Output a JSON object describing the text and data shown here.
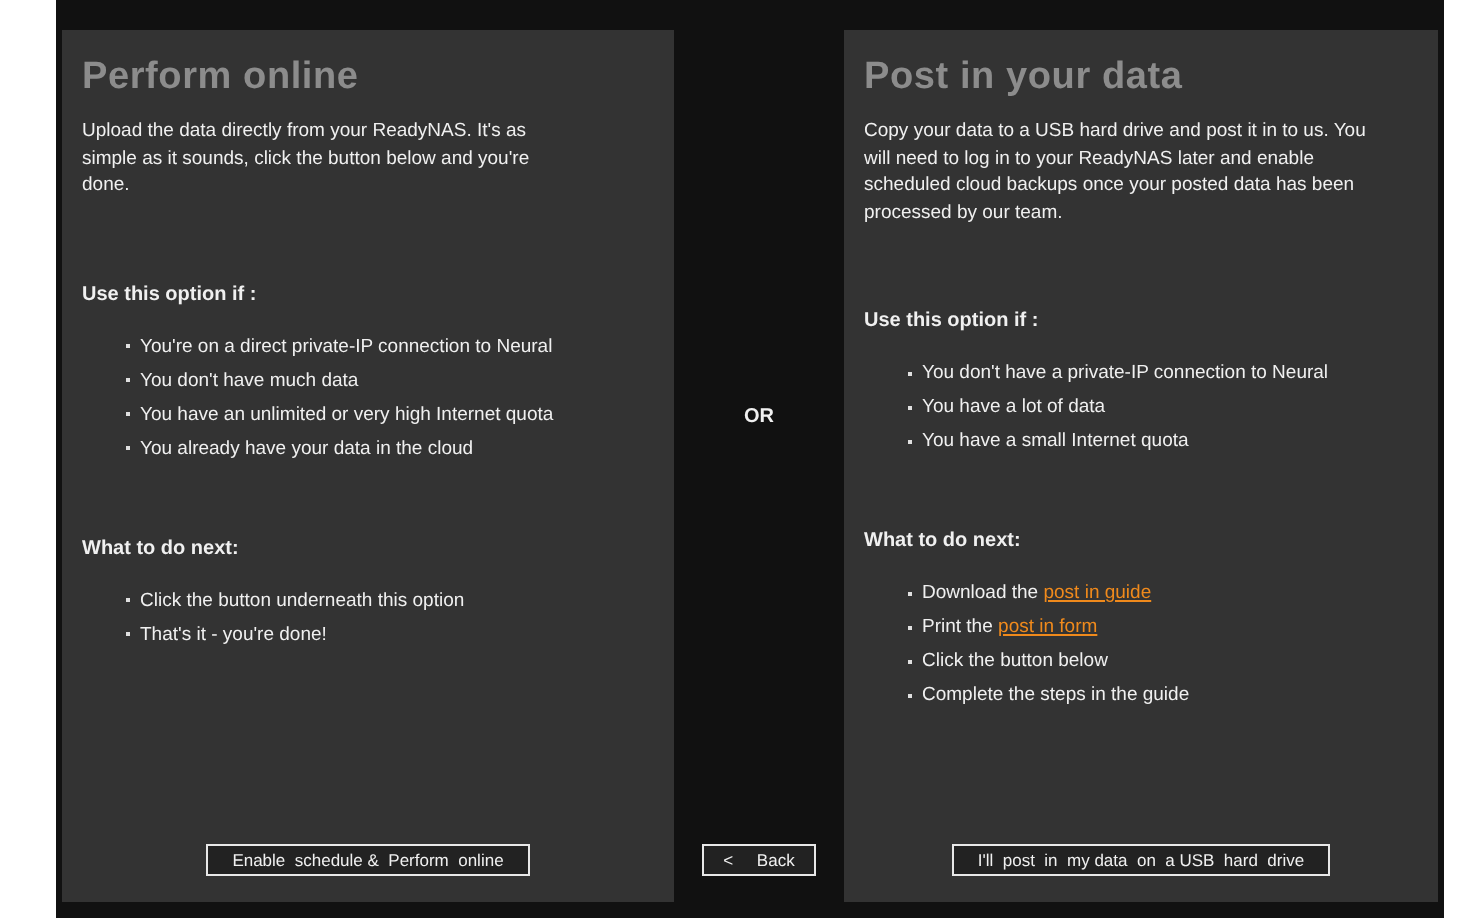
{
  "options": [
    {
      "title": "Perform online",
      "description": "Upload the data directly from your ReadyNAS. It's as simple as it sounds, click the button below and you're done.",
      "criteria_heading": "Use this option if :",
      "criteria": [
        "You're on a direct private-IP connection to Neural",
        "You don't have much data",
        "You have an unlimited or very high Internet quota",
        "You already have your data in the cloud"
      ],
      "next_heading": "What to do next:",
      "next_steps": [
        {
          "text": "Click the button underneath this option"
        },
        {
          "text": "That's it - you're done!"
        }
      ],
      "button": "Enable  schedule &  Perform  online"
    },
    {
      "title": "Post in your data",
      "description": "Copy your data to a USB hard drive and post it in to us. You will need to log in to your ReadyNAS later and enable scheduled cloud backups once your posted data has been processed by our team.",
      "criteria_heading": "Use this option if :",
      "criteria": [
        "You don't have a private-IP connection to Neural",
        "You have a lot of data",
        "You have a small Internet quota"
      ],
      "next_heading": "What to do next:",
      "next_steps": [
        {
          "text": "Download the ",
          "link": "post in guide"
        },
        {
          "text": "Print the ",
          "link": "post in form"
        },
        {
          "text": "Click the button below"
        },
        {
          "text": "Complete the steps in the guide"
        }
      ],
      "button": "I'll  post  in  my data  on  a USB  hard  drive"
    }
  ],
  "separator": "OR",
  "back_button": "<     Back"
}
